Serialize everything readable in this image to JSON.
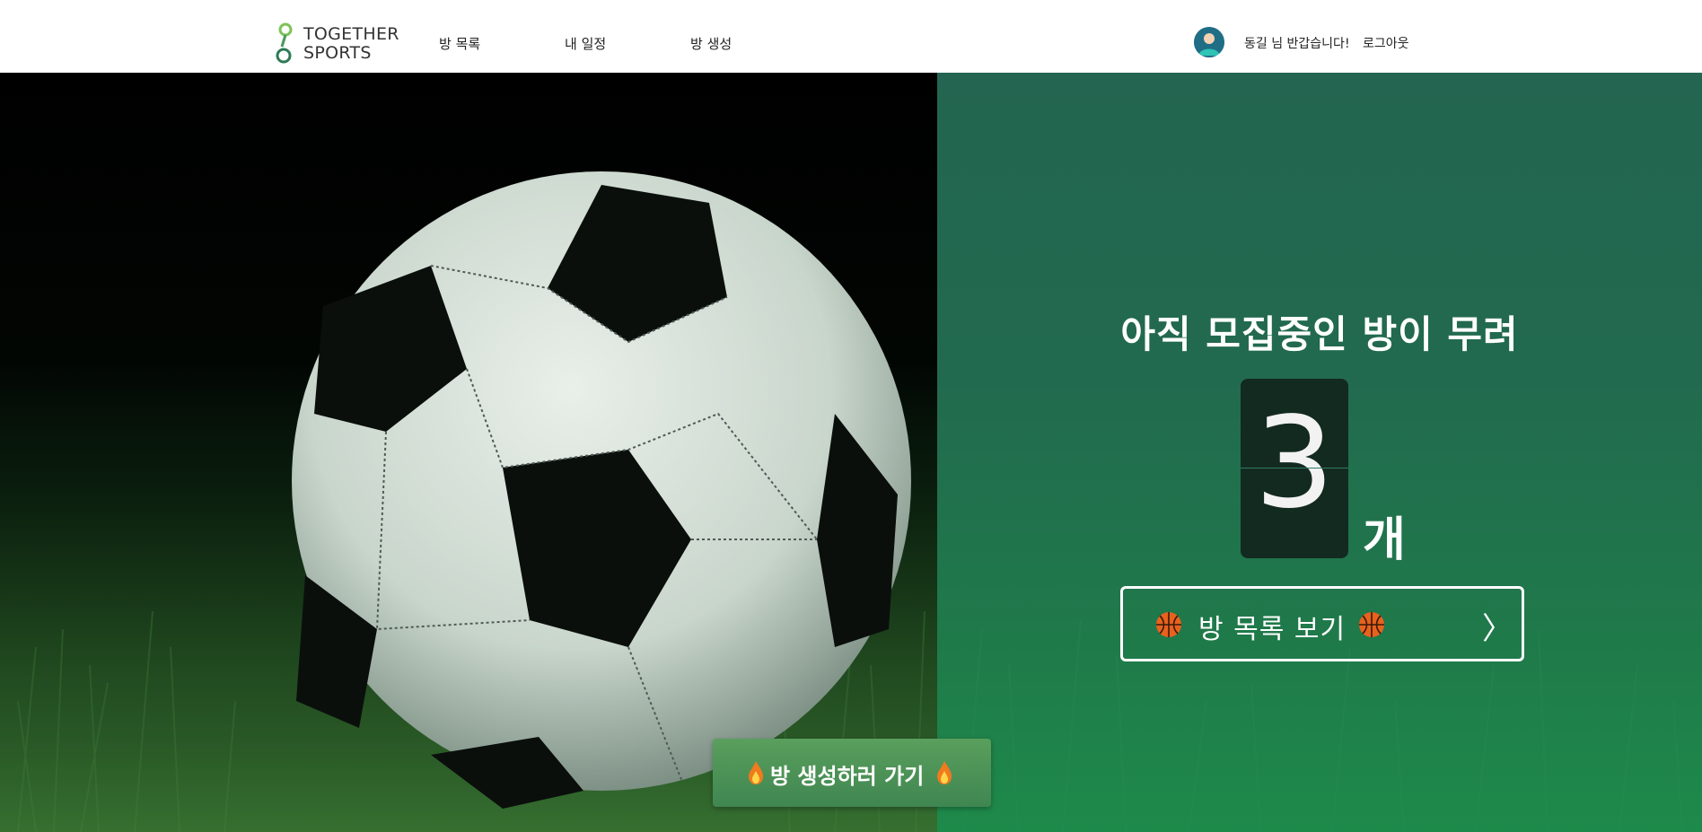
{
  "header": {
    "logo_line1": "TOGETHER",
    "logo_line2": "SPORTS",
    "nav": [
      {
        "label": "방 목록"
      },
      {
        "label": "내 일정"
      },
      {
        "label": "방 생성"
      }
    ],
    "greeting": "동길 님 반갑습니다!",
    "logout_label": "로그아웃"
  },
  "hero": {
    "headline": "아직 모집중인 방이 무려",
    "room_count": "3",
    "count_unit": "개",
    "list_button_label": "방 목록 보기",
    "list_button_icon": "basketball-icon",
    "chevron": "〉",
    "create_button_label": "방 생성하러 가기",
    "create_button_icon": "flame-icon"
  },
  "colors": {
    "brand_green": "#236550",
    "button_green": "#4a9356",
    "count_card": "#132a20"
  }
}
